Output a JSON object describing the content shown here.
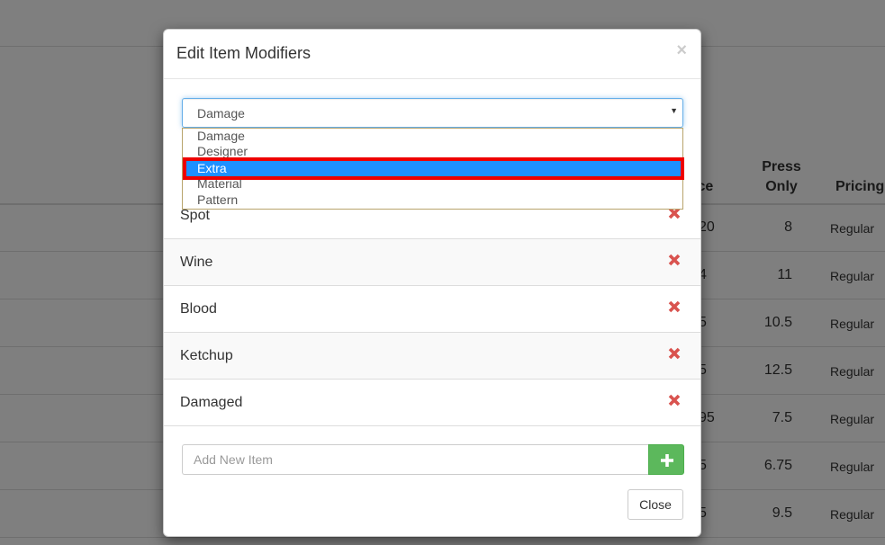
{
  "background": {
    "headers": [
      "ice",
      "Press Only",
      "Pricing"
    ],
    "rows": [
      {
        "price": "20",
        "press_only": "8",
        "pricing": "Regular"
      },
      {
        "price": "4",
        "press_only": "11",
        "pricing": "Regular"
      },
      {
        "price": "5",
        "press_only": "10.5",
        "pricing": "Regular"
      },
      {
        "price": "5",
        "press_only": "12.5",
        "pricing": "Regular"
      },
      {
        "price": "95",
        "press_only": "7.5",
        "pricing": "Regular"
      },
      {
        "price": "5",
        "press_only": "6.75",
        "pricing": "Regular"
      },
      {
        "price": "5",
        "press_only": "9.5",
        "pricing": "Regular"
      }
    ]
  },
  "modal": {
    "title": "Edit Item Modifiers",
    "close_symbol": "×",
    "select": {
      "value": "Damage",
      "options": [
        "Damage",
        "Designer",
        "Extra",
        "Material",
        "Pattern"
      ],
      "highlighted": "Extra"
    },
    "modifiers": [
      "Spot",
      "Wine",
      "Blood",
      "Ketchup",
      "Damaged"
    ],
    "delete_icon": "remove-x-icon",
    "add_placeholder": "Add New Item",
    "add_icon": "plus-icon",
    "close_label": "Close"
  },
  "colors": {
    "delete_red": "#d9534f",
    "add_green": "#5cb85c",
    "option_selected": "#1e90ff",
    "annotation_red": "#ee0000"
  }
}
